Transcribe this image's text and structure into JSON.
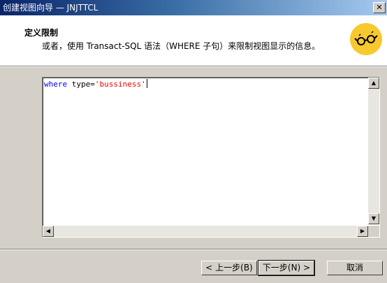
{
  "window": {
    "title": "创建视图向导 — JNJTTCL",
    "close_glyph": "✕"
  },
  "header": {
    "title": "定义限制",
    "description": "或者，使用 Transact-SQL 语法（WHERE 子句）来限制视图显示的信息。",
    "icon_name": "wizard-glasses-icon"
  },
  "editor": {
    "code_keyword": "where",
    "code_middle": " type=",
    "code_string": "'bussiness'"
  },
  "scroll": {
    "up": "▲",
    "down": "▼",
    "left": "◀",
    "right": "▶"
  },
  "buttons": {
    "back": "< 上一步(B)",
    "next": "下一步(N) >",
    "cancel": "取消"
  },
  "colors": {
    "titlebar_start": "#0a246a",
    "titlebar_end": "#a6caf0",
    "icon_bg": "#f7c92e",
    "keyword": "#0000ff",
    "string": "#ff0000"
  }
}
